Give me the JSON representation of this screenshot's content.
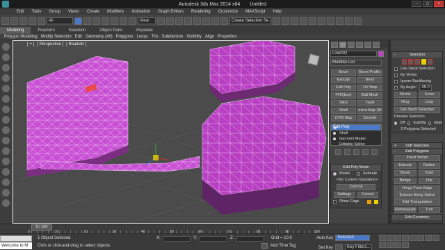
{
  "window": {
    "title": "Autodesk 3ds Max  2014 x64",
    "doc": "Untitled"
  },
  "menu": [
    "Edit",
    "Tools",
    "Group",
    "Views",
    "Create",
    "Modifiers",
    "Animation",
    "Graph Editors",
    "Rendering",
    "Customize",
    "MAXScript",
    "Help"
  ],
  "toolbar": {
    "selection_filter": "All",
    "ref_coord": "View",
    "named_selection": "Create Selection Se"
  },
  "ribbon": {
    "tabs": [
      "Modeling",
      "Freeform",
      "Selection",
      "Object Paint",
      "Populate"
    ],
    "active": "Modeling",
    "sub": [
      "Polygon Modeling",
      "Modify Selection",
      "Edit",
      "Geometry (All)",
      "Polygons",
      "Loops",
      "Tris",
      "Subdivision",
      "Visibility",
      "Align",
      "Properties"
    ]
  },
  "viewport": {
    "labels": [
      "[ + ]",
      "[ Perspective ]",
      "[ Realistic ]"
    ]
  },
  "command_panel": {
    "object_name": "Line002",
    "object_color": "#c13fca",
    "modifier_list": "Modifier List",
    "buttons": [
      "Bevel",
      "Bevel Profile",
      "Extrude",
      "Bend",
      "Edit Poly",
      "UV Map",
      "FFD(box)",
      "Edit Mesh",
      "Slice",
      "Twist",
      "Shell",
      "mera Map (W",
      "UVW Map",
      "Smooth"
    ],
    "stack": [
      "Edit Poly",
      "Shell",
      "Garment Maker",
      "Editable Spline"
    ],
    "stack_selected": 0,
    "edit_poly_mode": {
      "title": "Edit Poly Mode",
      "model": "Model",
      "animate": "Animate",
      "current_op": "<No Current Operation>",
      "commit": "Commit",
      "settings": "Settings",
      "cancel": "Cancel",
      "show_cage": "Show Cage"
    }
  },
  "selection_panel": {
    "title": "Selection",
    "use_stack": "Use Stack Selection",
    "by_vertex": "By Vertex",
    "ignore_backfacing": "Ignore Backfacing",
    "by_angle": "By Angle:",
    "by_angle_value": "45.0",
    "shrink": "Shrink",
    "grow": "Grow",
    "ring": "Ring",
    "loop": "Loop",
    "get_stack": "Get Stack Selection",
    "preview_title": "Preview Selection",
    "preview_off": "Off",
    "preview_subobj": "SubObj",
    "preview_multi": "Multi",
    "count": "2 Polygons Selected"
  },
  "rollouts": {
    "soft_selection": "Soft Selection",
    "edit_polygons": "Edit Polygons",
    "insert_vertex": "Insert Vertex",
    "extrude": "Extrude",
    "outline": "Outline",
    "bevel": "Bevel",
    "inset": "Inset",
    "bridge": "Bridge",
    "flip": "Flip",
    "hinge": "Hinge From Edge",
    "extrude_spline": "Extrude Along Spline",
    "edit_tri": "Edit Triangulation",
    "retriangulate": "Retriangulate",
    "turn": "Turn",
    "edit_geometry": "Edit Geometry",
    "repeat_last": "Repeat Last"
  },
  "timeline": {
    "slider": "0 / 100",
    "ticks": [
      "0",
      "10",
      "20",
      "30",
      "40",
      "50",
      "60",
      "70",
      "80",
      "90",
      "100"
    ]
  },
  "status": {
    "maxscript_prompt": "Welcome to M",
    "objects_selected": "1 Object Selected",
    "prompt": "Click or click-and-drag to select objects",
    "x_label": "X:",
    "y_label": "Y:",
    "z_label": "Z:",
    "grid": "Grid = 10.0",
    "add_time_tag": "Add Time Tag",
    "auto_key": "Auto Key",
    "auto_key_value": "Selected",
    "set_key": "Set Key",
    "key_filters": "Key Filters..."
  }
}
